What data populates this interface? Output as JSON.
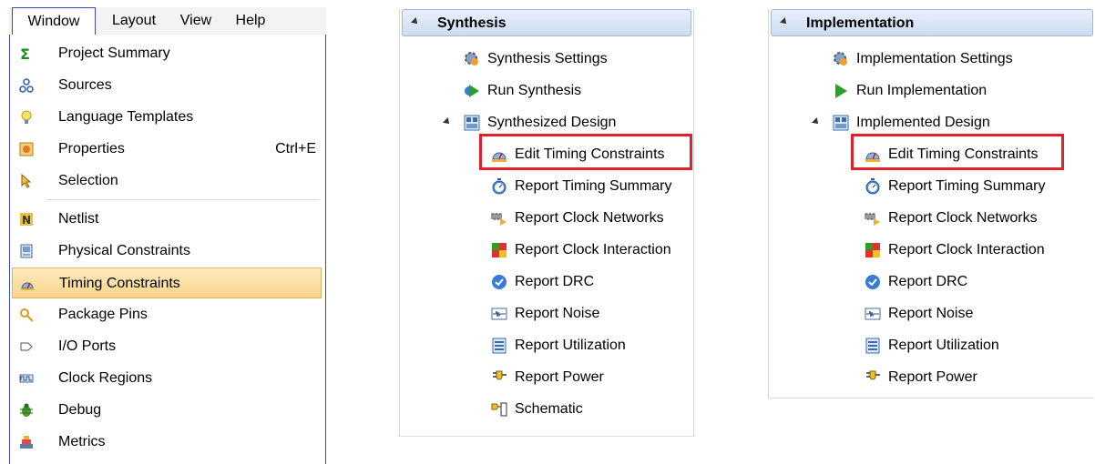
{
  "menubar": {
    "window": "Window",
    "layout": "Layout",
    "view": "View",
    "help": "Help"
  },
  "window_menu": {
    "items": [
      {
        "label": "Project Summary",
        "icon": "sigma-icon"
      },
      {
        "label": "Sources",
        "icon": "sources-icon"
      },
      {
        "label": "Language Templates",
        "icon": "lightbulb-icon"
      },
      {
        "label": "Properties",
        "shortcut": "Ctrl+E",
        "icon": "properties-icon"
      },
      {
        "label": "Selection",
        "icon": "cursor-icon"
      },
      {
        "label": "Netlist",
        "icon": "netlist-icon"
      },
      {
        "label": "Physical Constraints",
        "icon": "physical-constraints-icon"
      },
      {
        "label": "Timing Constraints",
        "icon": "timing-constraints-icon",
        "highlighted": true
      },
      {
        "label": "Package Pins",
        "icon": "package-pins-icon"
      },
      {
        "label": "I/O Ports",
        "icon": "io-ports-icon"
      },
      {
        "label": "Clock Regions",
        "icon": "clock-regions-icon"
      },
      {
        "label": "Debug",
        "icon": "debug-bug-icon"
      },
      {
        "label": "Metrics",
        "icon": "metrics-icon"
      }
    ]
  },
  "synthesis": {
    "title": "Synthesis",
    "settings": "Synthesis Settings",
    "run": "Run Synthesis",
    "design": "Synthesized Design",
    "reports": [
      "Edit Timing Constraints",
      "Report Timing Summary",
      "Report Clock Networks",
      "Report Clock Interaction",
      "Report DRC",
      "Report Noise",
      "Report Utilization",
      "Report Power",
      "Schematic"
    ]
  },
  "implementation": {
    "title": "Implementation",
    "settings": "Implementation Settings",
    "run": "Run Implementation",
    "design": "Implemented Design",
    "reports": [
      "Edit Timing Constraints",
      "Report Timing Summary",
      "Report Clock Networks",
      "Report Clock Interaction",
      "Report DRC",
      "Report Noise",
      "Report Utilization",
      "Report Power"
    ]
  },
  "colors": {
    "highlight_box": "#e0202a",
    "menu_border": "#3a4abd",
    "menu_highlight": "#f8d68b"
  }
}
